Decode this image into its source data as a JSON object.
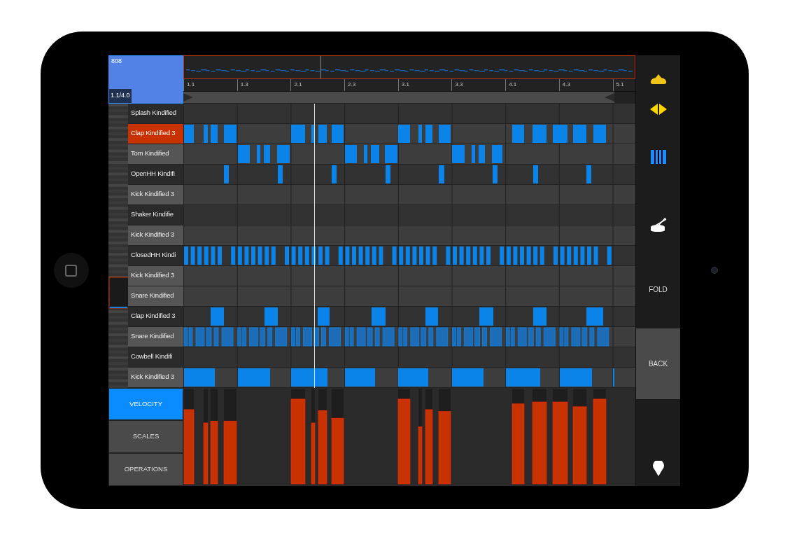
{
  "pattern": {
    "name": "808",
    "position": "1.1/4.0"
  },
  "ruler": {
    "markers": [
      "1.1",
      "1.3",
      "2.1",
      "2.3",
      "3.1",
      "3.3",
      "4.1",
      "4.3",
      "5.1"
    ]
  },
  "tracks": [
    {
      "name": "Splash Kindified",
      "selected": false,
      "highlighted": false
    },
    {
      "name": "Clap Kindified 3",
      "selected": true,
      "highlighted": false
    },
    {
      "name": "Tom Kindified",
      "selected": false,
      "highlighted": true
    },
    {
      "name": "OpenHH Kindifi",
      "selected": false,
      "highlighted": false
    },
    {
      "name": "Kick Kindified 3",
      "selected": false,
      "highlighted": true
    },
    {
      "name": "Shaker Kindifie",
      "selected": false,
      "highlighted": false
    },
    {
      "name": "Kick Kindified 3",
      "selected": false,
      "highlighted": true
    },
    {
      "name": "ClosedHH Kindi",
      "selected": false,
      "highlighted": false
    },
    {
      "name": "Kick Kindified 3",
      "selected": false,
      "highlighted": true
    },
    {
      "name": "Snare Kindified",
      "selected": false,
      "highlighted": true
    },
    {
      "name": "Clap Kindified 3",
      "selected": false,
      "highlighted": false
    },
    {
      "name": "Snare Kindified",
      "selected": false,
      "highlighted": true
    },
    {
      "name": "Cowbell Kindifi",
      "selected": false,
      "highlighted": false
    },
    {
      "name": "Kick Kindified 3",
      "selected": false,
      "highlighted": true
    }
  ],
  "tabs": [
    {
      "label": "VELOCITY",
      "selected": true
    },
    {
      "label": "SCALES",
      "selected": false
    },
    {
      "label": "OPERATIONS",
      "selected": false
    }
  ],
  "velocity": {
    "bars": [
      {
        "level": 0.78
      },
      {
        "level": 0.64
      },
      {
        "level": 0.66
      },
      {
        "level": 0.66
      },
      {
        "level": 0.89
      },
      {
        "level": 0.64
      },
      {
        "level": 0.77
      },
      {
        "level": 0.69
      },
      {
        "level": 0.89
      },
      {
        "level": 0.6
      },
      {
        "level": 0.78
      },
      {
        "level": 0.76
      },
      {
        "level": 0.84
      },
      {
        "level": 0.86
      },
      {
        "level": 0.86
      },
      {
        "level": 0.81
      },
      {
        "level": 0.89
      }
    ]
  },
  "sidebar": {
    "fold": "FOLD",
    "back": "BACK"
  }
}
